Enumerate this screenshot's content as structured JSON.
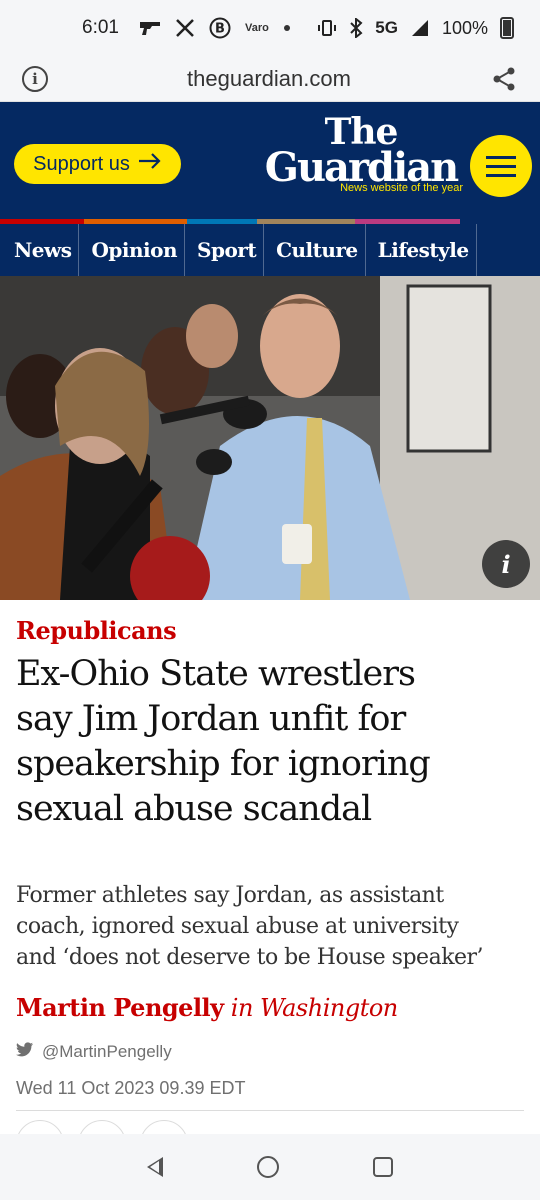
{
  "status_bar": {
    "time": "6:01",
    "network": "5G",
    "battery": "100%",
    "icons": [
      "gun-icon",
      "x-logo-icon",
      "bitcoin-icon",
      "varo-icon",
      "dot-icon",
      "vibrate-icon",
      "bluetooth-icon",
      "signal-icon",
      "battery-icon"
    ],
    "varo_label": "Varo"
  },
  "browser": {
    "url": "theguardian.com"
  },
  "header": {
    "support_label": "Support us",
    "logo_the": "The",
    "logo_guardian": "Guardian",
    "logo_tagline": "News website of the year",
    "brand_color": "#052962",
    "accent_color": "#ffe500",
    "pillar_colors": [
      "#c70000",
      "#e05e00",
      "#0077b6",
      "#a1845c",
      "#bb3b80"
    ]
  },
  "nav": {
    "items": [
      "News",
      "Opinion",
      "Sport",
      "Culture",
      "Lifestyle"
    ]
  },
  "hero": {
    "info_label": "i"
  },
  "article": {
    "kicker": "Republicans",
    "headline_lines": [
      "Ex-Ohio State wrestlers",
      "say Jim Jordan unfit for",
      "speakership for ignoring",
      "sexual abuse scandal"
    ],
    "standfirst_lines": [
      "Former athletes say Jordan, as assistant",
      "coach, ignored sexual abuse at university",
      "and ‘does not deserve to be House speaker’"
    ],
    "byline_name": "Martin Pengelly",
    "byline_location": "in Washington",
    "twitter_handle": "@MartinPengelly",
    "date": "Wed 11 Oct 2023 09.39 EDT"
  }
}
